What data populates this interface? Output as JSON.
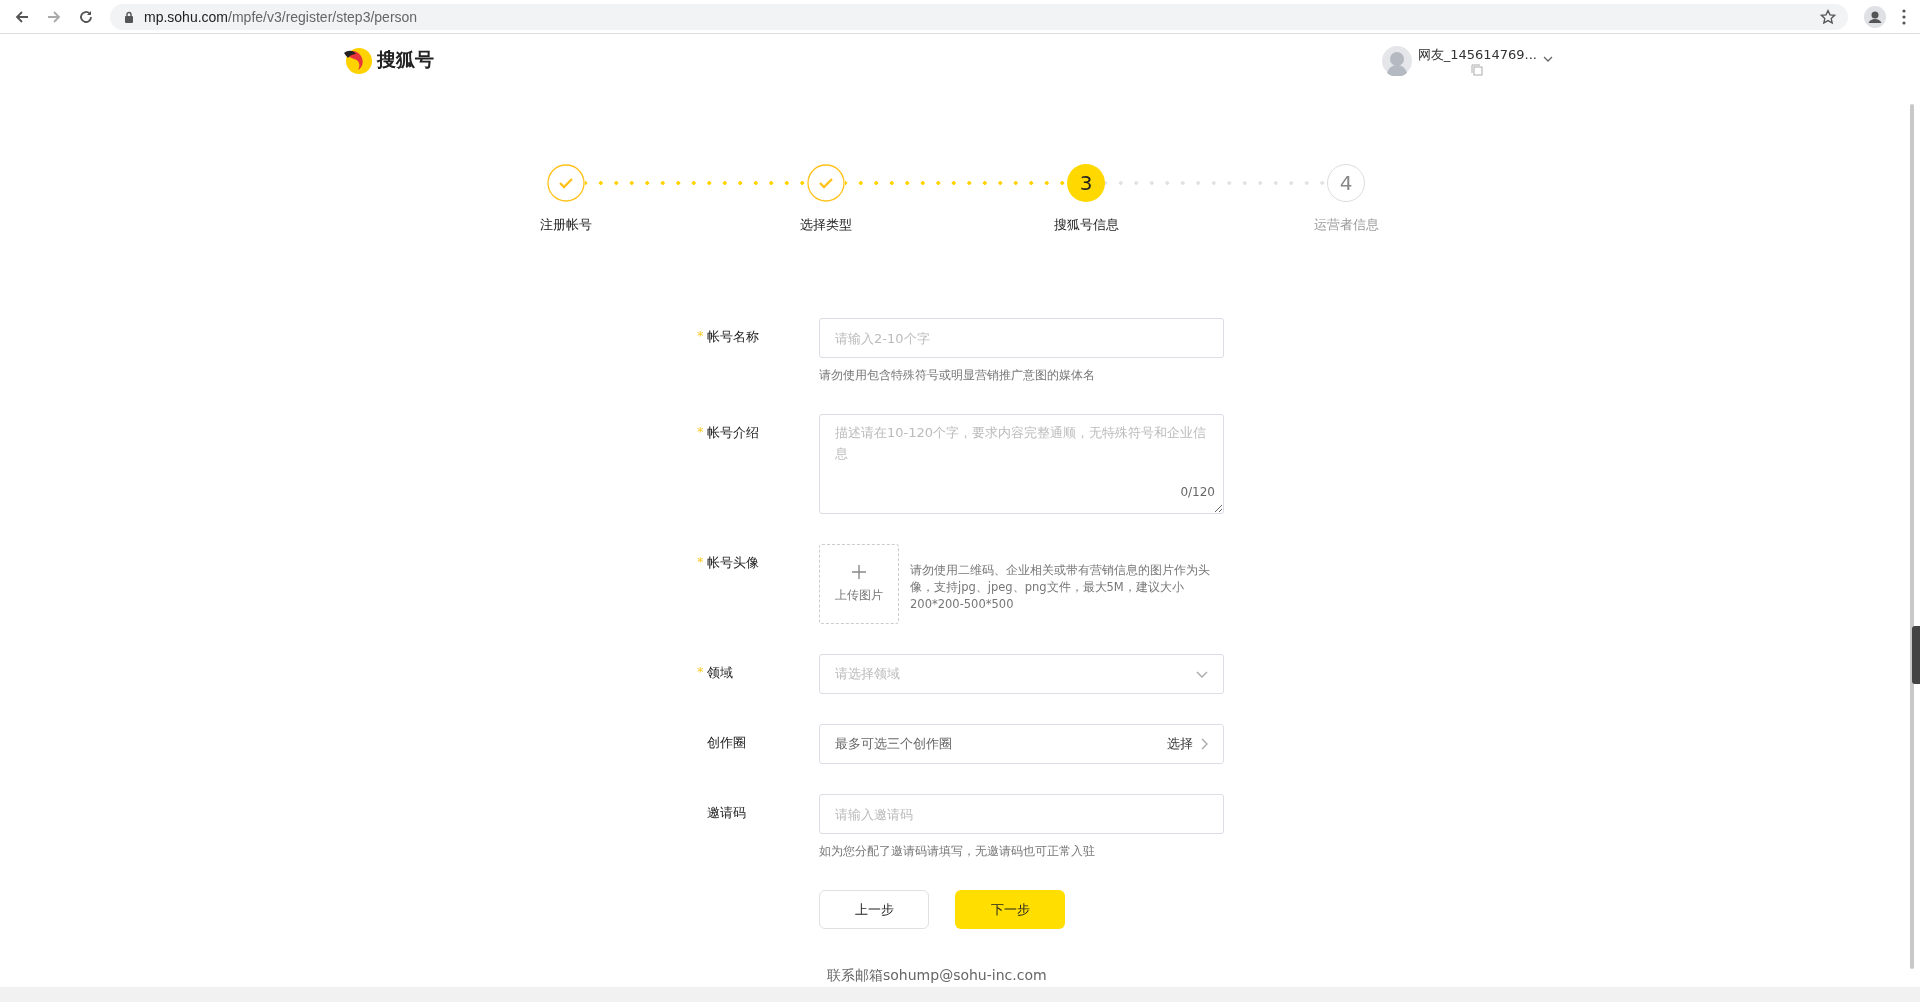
{
  "browser": {
    "url_host": "mp.sohu.com",
    "url_path": "/mpfe/v3/register/step3/person"
  },
  "header": {
    "logo_text": "搜狐号",
    "user_name": "网友_145614769..."
  },
  "steps": [
    {
      "label": "注册帐号",
      "kind": "done"
    },
    {
      "label": "选择类型",
      "kind": "done"
    },
    {
      "label": "搜狐号信息",
      "kind": "current",
      "number": "3"
    },
    {
      "label": "运营者信息",
      "kind": "todo",
      "number": "4"
    }
  ],
  "form": [
    {
      "label": "帐号名称",
      "required_mark": "*",
      "kind": "text",
      "placeholder": "请输入2-10个字",
      "help": "请勿使用包含特殊符号或明显营销推广意图的媒体名"
    },
    {
      "label": "帐号介绍",
      "required_mark": "*",
      "kind": "textarea",
      "placeholder": "描述请在10-120个字，要求内容完整通顺，无特殊符号和企业信息",
      "counter": "0/120"
    },
    {
      "label": "帐号头像",
      "required_mark": "*",
      "kind": "upload",
      "button": "上传图片",
      "hint": "请勿使用二维码、企业相关或带有营销信息的图片作为头像，支持jpg、jpeg、png文件，最大5M，建议大小200*200-500*500"
    },
    {
      "label": "领域",
      "required_mark": "*",
      "kind": "select",
      "placeholder": "请选择领域"
    },
    {
      "label": "创作圈",
      "kind": "picker",
      "value": "最多可选三个创作圈",
      "action": "选择"
    },
    {
      "label": "邀请码",
      "kind": "text",
      "placeholder": "请输入邀请码",
      "help": "如为您分配了邀请码请填写，无邀请码也可正常入驻"
    }
  ],
  "buttons": {
    "prev": "上一步",
    "next": "下一步"
  },
  "footer": "联系邮箱sohump@sohu-inc.com"
}
